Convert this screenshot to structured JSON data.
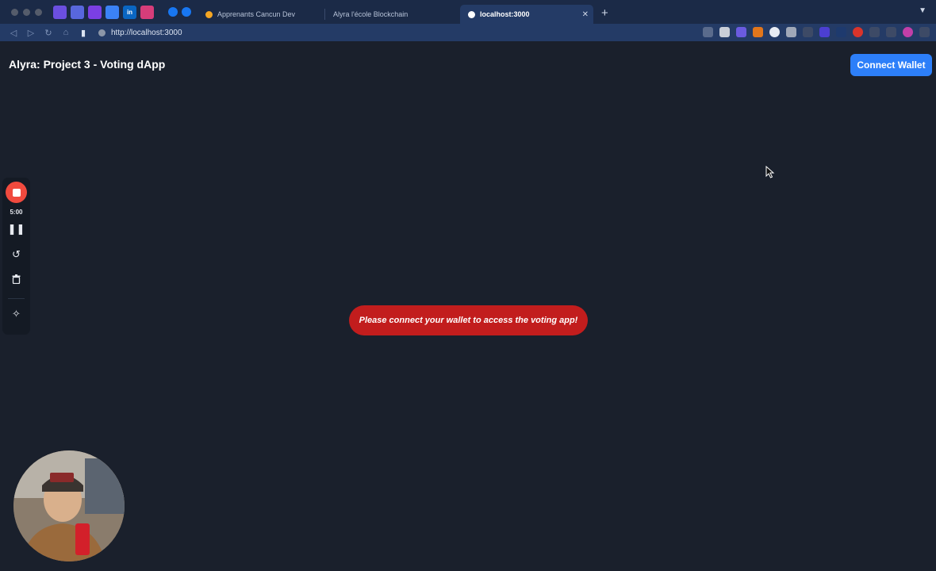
{
  "browser": {
    "tabs": [
      {
        "label": "Apprenants Cancun Dev",
        "active": false
      },
      {
        "label": "Alyra l'école Blockchain",
        "active": false
      },
      {
        "label": "localhost:3000",
        "active": true
      }
    ],
    "url": "http://localhost:3000"
  },
  "app": {
    "title": "Alyra: Project 3 - Voting dApp",
    "connect_label": "Connect Wallet",
    "alert_message": "Please connect your wallet to access the voting app!"
  },
  "recorder": {
    "time": "5:00"
  },
  "colors": {
    "page_bg": "#1a202c",
    "accent": "#2d7ff9",
    "alert": "#c21d1d"
  }
}
